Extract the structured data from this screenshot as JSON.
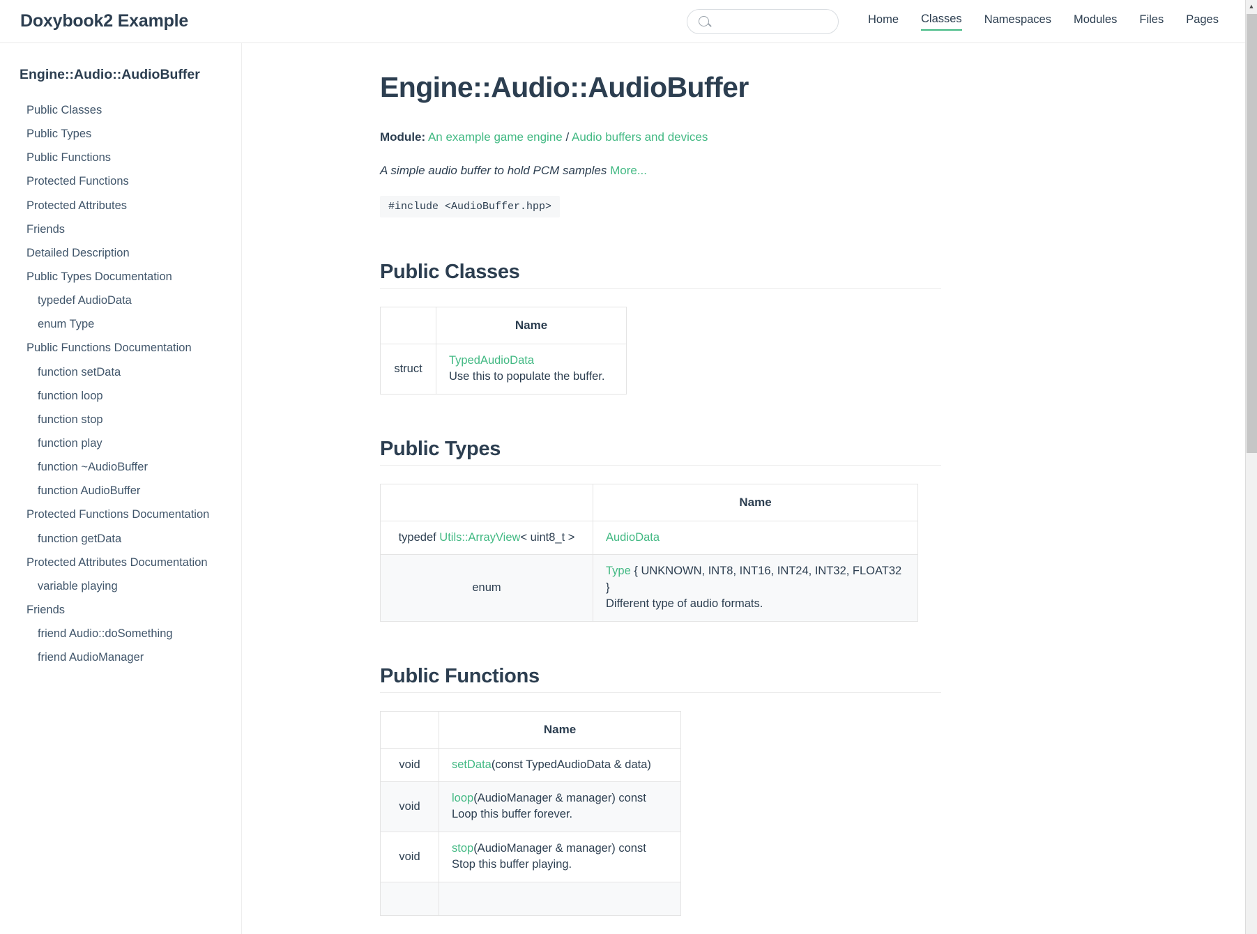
{
  "header": {
    "brand": "Doxybook2 Example",
    "search": {
      "value": "",
      "placeholder": ""
    },
    "nav": [
      {
        "label": "Home",
        "active": false
      },
      {
        "label": "Classes",
        "active": true
      },
      {
        "label": "Namespaces",
        "active": false
      },
      {
        "label": "Modules",
        "active": false
      },
      {
        "label": "Files",
        "active": false
      },
      {
        "label": "Pages",
        "active": false
      }
    ]
  },
  "sidebar": {
    "title": "Engine::Audio::AudioBuffer",
    "items": [
      {
        "label": "Public Classes",
        "level": 1
      },
      {
        "label": "Public Types",
        "level": 1
      },
      {
        "label": "Public Functions",
        "level": 1
      },
      {
        "label": "Protected Functions",
        "level": 1
      },
      {
        "label": "Protected Attributes",
        "level": 1
      },
      {
        "label": "Friends",
        "level": 1
      },
      {
        "label": "Detailed Description",
        "level": 1
      },
      {
        "label": "Public Types Documentation",
        "level": 1
      },
      {
        "label": "typedef AudioData",
        "level": 2
      },
      {
        "label": "enum Type",
        "level": 2
      },
      {
        "label": "Public Functions Documentation",
        "level": 1
      },
      {
        "label": "function setData",
        "level": 2
      },
      {
        "label": "function loop",
        "level": 2
      },
      {
        "label": "function stop",
        "level": 2
      },
      {
        "label": "function play",
        "level": 2
      },
      {
        "label": "function ~AudioBuffer",
        "level": 2
      },
      {
        "label": "function AudioBuffer",
        "level": 2
      },
      {
        "label": "Protected Functions Documentation",
        "level": 1
      },
      {
        "label": "function getData",
        "level": 2
      },
      {
        "label": "Protected Attributes Documentation",
        "level": 1
      },
      {
        "label": "variable playing",
        "level": 2
      },
      {
        "label": "Friends",
        "level": 1
      },
      {
        "label": "friend Audio::doSomething",
        "level": 2
      },
      {
        "label": "friend AudioManager",
        "level": 2
      }
    ]
  },
  "main": {
    "title": "Engine::Audio::AudioBuffer",
    "module_label": "Module:",
    "module_links": [
      "An example game engine",
      "Audio buffers and devices"
    ],
    "module_separator": "/",
    "brief": "A simple audio buffer to hold PCM samples",
    "more_label": "More...",
    "include": "#include <AudioBuffer.hpp>",
    "sections": [
      {
        "heading": "Public Classes",
        "column_header": "Name",
        "rows": [
          {
            "type": "struct",
            "name": "TypedAudioData",
            "suffix": "",
            "description": "Use this to populate the buffer."
          }
        ]
      },
      {
        "heading": "Public Types",
        "column_header": "Name",
        "rows": [
          {
            "type_prefix": "typedef ",
            "type_link": "Utils::ArrayView",
            "type_suffix": "< uint8_t >",
            "name": "AudioData",
            "suffix": "",
            "description": ""
          },
          {
            "type_prefix": "enum",
            "type_link": "",
            "type_suffix": "",
            "name": "Type",
            "suffix": " { UNKNOWN, INT8, INT16, INT24, INT32, FLOAT32 }",
            "description": "Different type of audio formats."
          }
        ]
      },
      {
        "heading": "Public Functions",
        "column_header": "Name",
        "rows": [
          {
            "type": "void",
            "name": "setData",
            "suffix": "(const TypedAudioData & data)",
            "description": ""
          },
          {
            "type": "void",
            "name": "loop",
            "suffix": "(AudioManager & manager) const",
            "description": "Loop this buffer forever."
          },
          {
            "type": "void",
            "name": "stop",
            "suffix": "(AudioManager & manager) const",
            "description": "Stop this buffer playing."
          }
        ]
      }
    ]
  },
  "colors": {
    "accent": "#42b983",
    "text": "#2c3e50",
    "border": "#e4e4e4",
    "stripe": "#f8f9fa"
  }
}
